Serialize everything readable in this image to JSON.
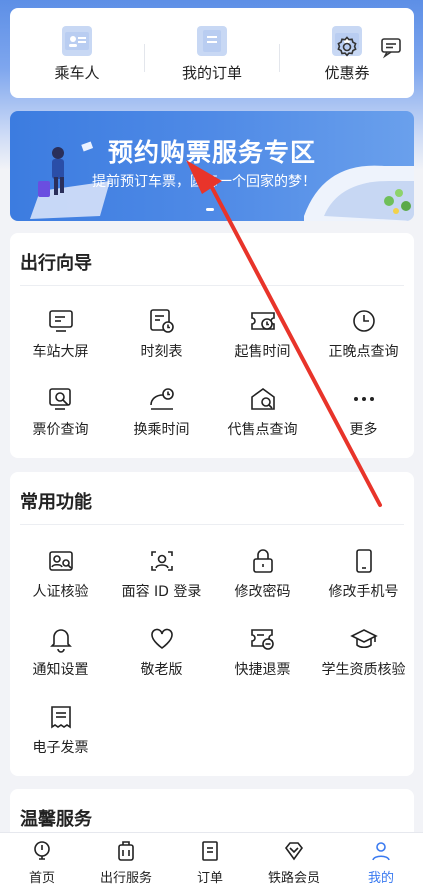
{
  "status": {
    "time": ""
  },
  "top_quick": [
    {
      "label": "乘车人",
      "icon": "passenger-icon"
    },
    {
      "label": "我的订单",
      "icon": "order-icon"
    },
    {
      "label": "优惠券",
      "icon": "coupon-icon"
    }
  ],
  "top_icons": [
    "settings-icon",
    "message-icon"
  ],
  "banner": {
    "title": "预约购票服务专区",
    "subtitle": "提前预订车票，圆每一个回家的梦！"
  },
  "travel_guide": {
    "title": "出行向导",
    "items": [
      {
        "label": "车站大屏",
        "icon": "station-screen-icon"
      },
      {
        "label": "时刻表",
        "icon": "timetable-icon"
      },
      {
        "label": "起售时间",
        "icon": "sale-time-icon"
      },
      {
        "label": "正晚点查询",
        "icon": "clock-icon"
      },
      {
        "label": "票价查询",
        "icon": "fare-icon"
      },
      {
        "label": "换乘时间",
        "icon": "transfer-icon"
      },
      {
        "label": "代售点查询",
        "icon": "agency-icon"
      },
      {
        "label": "更多",
        "icon": "more-icon"
      }
    ]
  },
  "common_functions": {
    "title": "常用功能",
    "items": [
      {
        "label": "人证核验",
        "icon": "id-verify-icon"
      },
      {
        "label": "面容 ID 登录",
        "icon": "face-id-icon"
      },
      {
        "label": "修改密码",
        "icon": "lock-icon"
      },
      {
        "label": "修改手机号",
        "icon": "phone-icon"
      },
      {
        "label": "通知设置",
        "icon": "bell-icon"
      },
      {
        "label": "敬老版",
        "icon": "heart-icon"
      },
      {
        "label": "快捷退票",
        "icon": "refund-icon"
      },
      {
        "label": "学生资质核验",
        "icon": "graduation-cap-icon"
      },
      {
        "label": "电子发票",
        "icon": "invoice-icon"
      }
    ]
  },
  "warm_service": {
    "title": "温馨服务"
  },
  "tabbar": [
    {
      "label": "首页",
      "icon": "home-icon"
    },
    {
      "label": "出行服务",
      "icon": "travel-service-icon"
    },
    {
      "label": "订单",
      "icon": "order-tab-icon"
    },
    {
      "label": "铁路会员",
      "icon": "member-icon"
    },
    {
      "label": "我的",
      "icon": "profile-icon",
      "active": true
    }
  ],
  "colors": {
    "accent": "#3a7af0",
    "banner": "#3c7ce0",
    "annotation_arrow": "#e8342a"
  }
}
